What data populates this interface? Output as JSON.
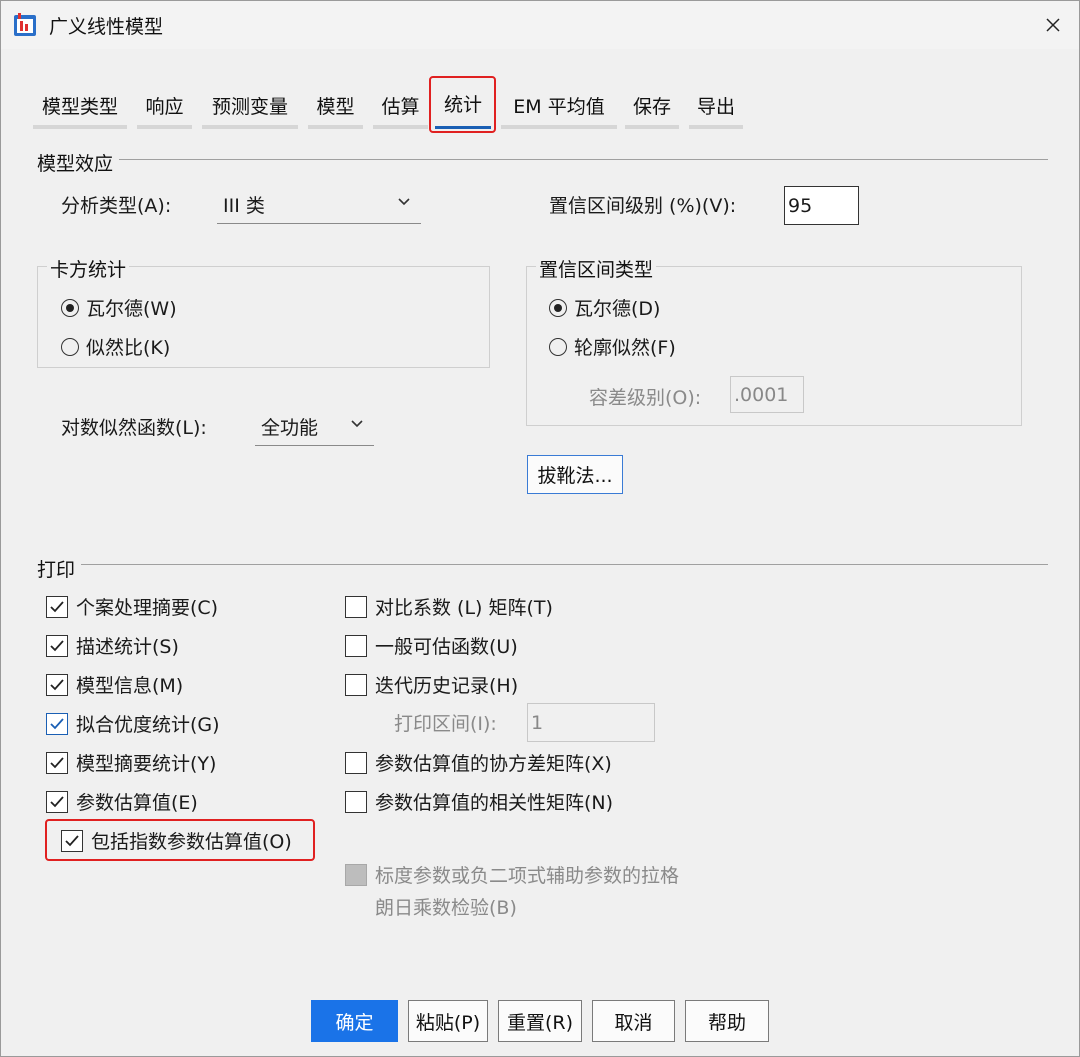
{
  "window": {
    "title": "广义线性模型"
  },
  "tabs": [
    {
      "label": "模型类型",
      "active": false
    },
    {
      "label": "响应",
      "active": false
    },
    {
      "label": "预测变量",
      "active": false
    },
    {
      "label": "模型",
      "active": false
    },
    {
      "label": "估算",
      "active": false
    },
    {
      "label": "统计",
      "active": true
    },
    {
      "label": "EM 平均值",
      "active": false
    },
    {
      "label": "保存",
      "active": false
    },
    {
      "label": "导出",
      "active": false
    }
  ],
  "model_effects": {
    "section_title": "模型效应",
    "analysis_type_label": "分析类型(A):",
    "analysis_type_value": "III 类",
    "ci_level_label": "置信区间级别 (%)(V):",
    "ci_level_value": "95",
    "chi_square": {
      "title": "卡方统计",
      "options": [
        {
          "label": "瓦尔德(W)",
          "selected": true
        },
        {
          "label": "似然比(K)",
          "selected": false
        }
      ]
    },
    "ci_type": {
      "title": "置信区间类型",
      "options": [
        {
          "label": "瓦尔德(D)",
          "selected": true
        },
        {
          "label": "轮廓似然(F)",
          "selected": false
        }
      ],
      "tolerance_label": "容差级别(O):",
      "tolerance_value": ".0001"
    },
    "log_likelihood_label": "对数似然函数(L):",
    "log_likelihood_value": "全功能",
    "bootstrap_button": "拔靴法..."
  },
  "print": {
    "section_title": "打印",
    "left_items": [
      {
        "label": "个案处理摘要(C)",
        "checked": true
      },
      {
        "label": "描述统计(S)",
        "checked": true
      },
      {
        "label": "模型信息(M)",
        "checked": true
      },
      {
        "label": "拟合优度统计(G)",
        "checked": true
      },
      {
        "label": "模型摘要统计(Y)",
        "checked": true
      },
      {
        "label": "参数估算值(E)",
        "checked": true
      },
      {
        "label": "包括指数参数估算值(O)",
        "checked": true
      }
    ],
    "right_items": [
      {
        "label": "对比系数 (L) 矩阵(T)",
        "checked": false
      },
      {
        "label": "一般可估函数(U)",
        "checked": false
      },
      {
        "label": "迭代历史记录(H)",
        "checked": false
      },
      {
        "label": "参数估算值的协方差矩阵(X)",
        "checked": false
      },
      {
        "label": "参数估算值的相关性矩阵(N)",
        "checked": false
      }
    ],
    "print_interval_label": "打印区间(I):",
    "print_interval_value": "1",
    "lagrange_line1": "标度参数或负二项式辅助参数的拉格",
    "lagrange_line2": "朗日乘数检验(B)"
  },
  "buttons": {
    "ok": "确定",
    "paste": "粘贴(P)",
    "reset": "重置(R)",
    "cancel": "取消",
    "help": "帮助"
  },
  "colors": {
    "accent": "#1a73e8",
    "highlight": "#e02020"
  }
}
